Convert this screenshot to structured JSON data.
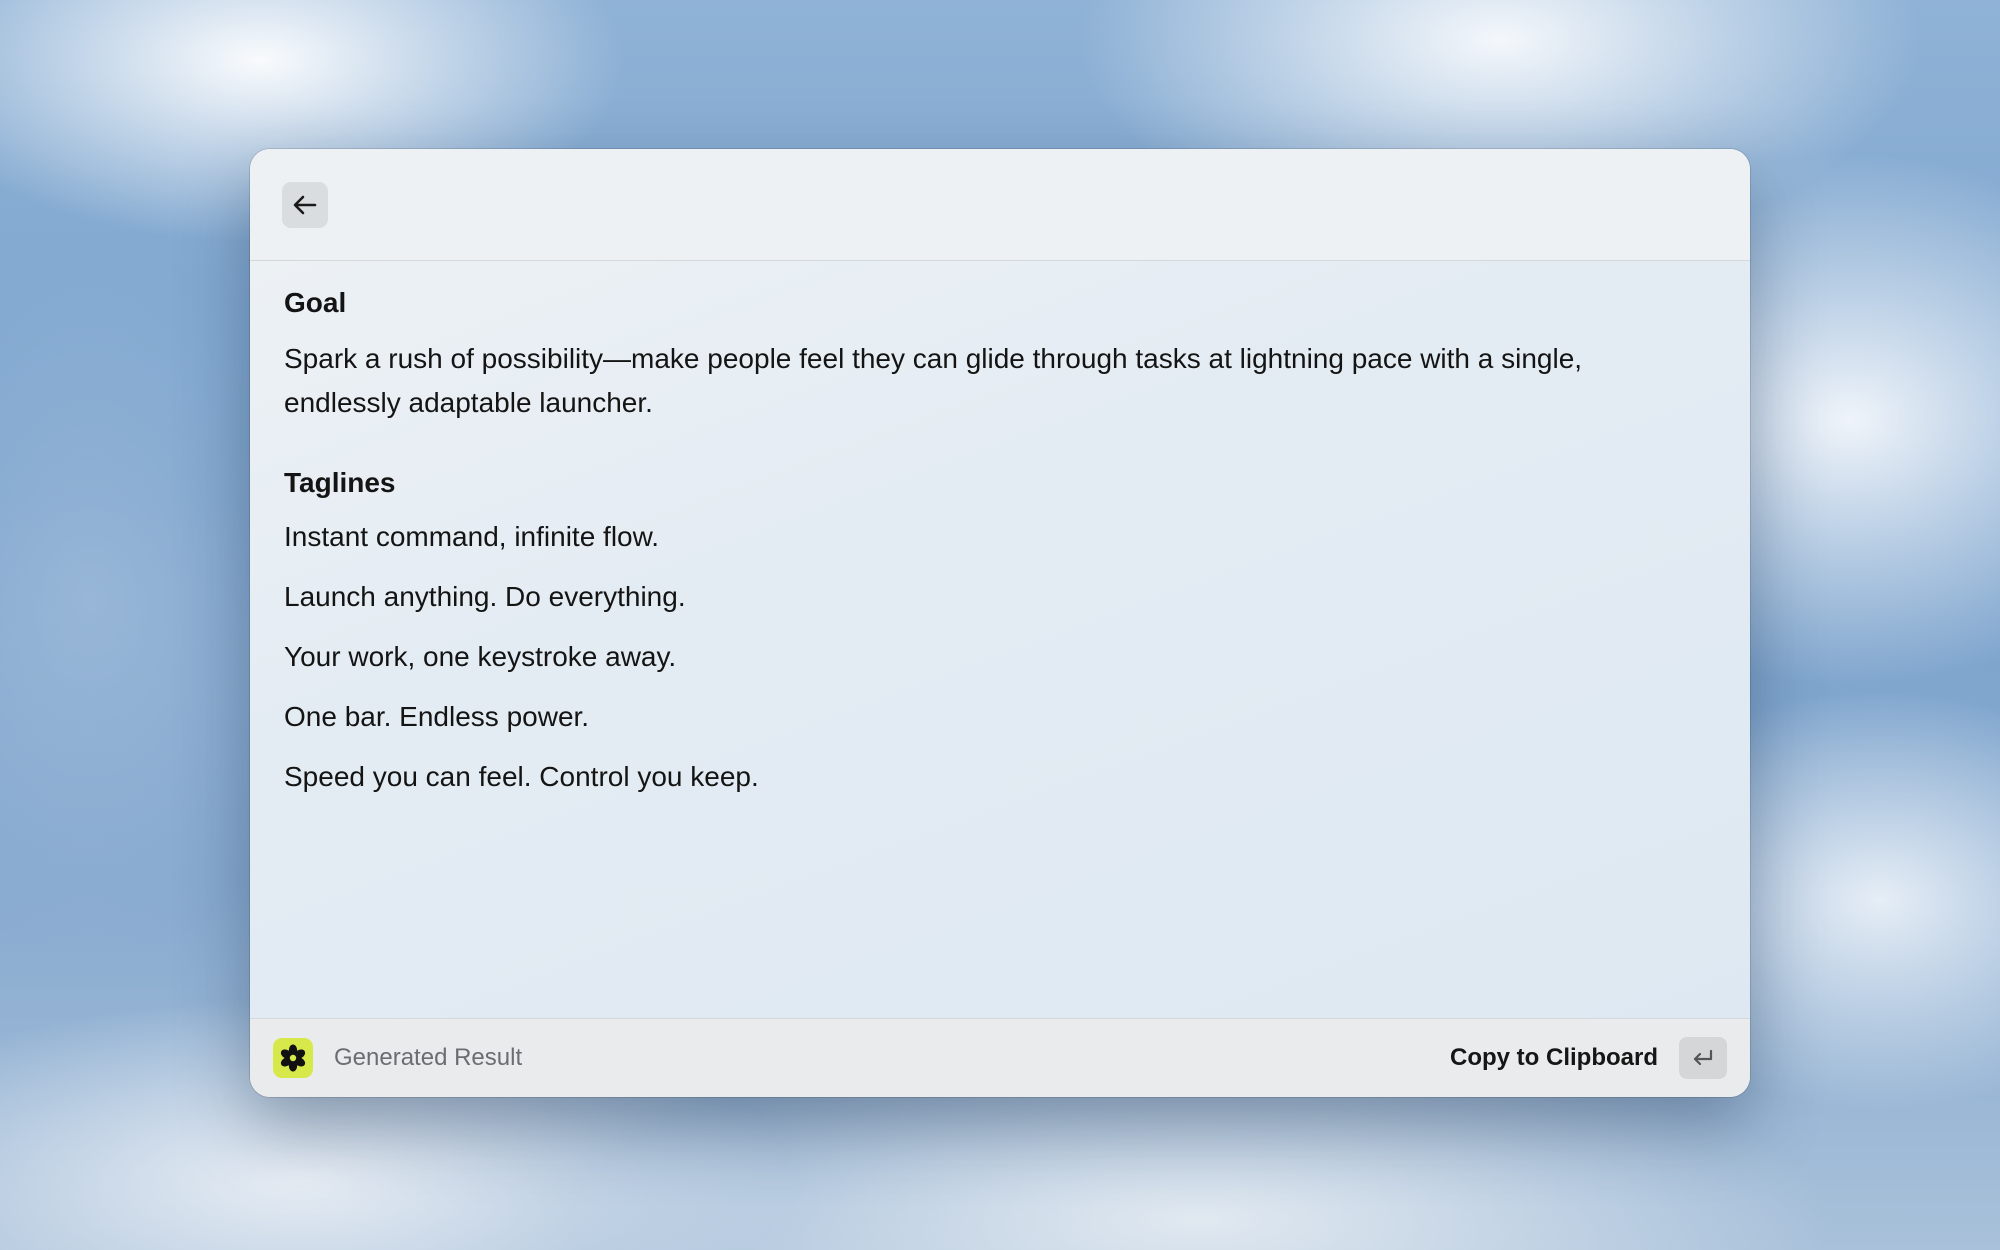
{
  "window": {
    "header": {
      "back_icon": "arrow-left-icon"
    },
    "content": {
      "goal": {
        "title": "Goal",
        "text": "Spark a rush of possibility—make people feel they can glide through tasks at lightning pace with a single, endlessly adaptable launcher."
      },
      "taglines": {
        "title": "Taglines",
        "items": [
          "Instant command, infinite flow.",
          "Launch anything. Do everything.",
          "Your work, one keystroke away.",
          "One bar. Endless power.",
          "Speed you can feel. Control you keep."
        ]
      }
    },
    "footer": {
      "app_icon": "flower-icon",
      "label": "Generated Result",
      "action_label": "Copy to Clipboard",
      "action_key_icon": "return-key-icon"
    }
  },
  "colors": {
    "accent": "#d7e84a",
    "text": "#141414",
    "muted_text": "#6b6e71"
  }
}
